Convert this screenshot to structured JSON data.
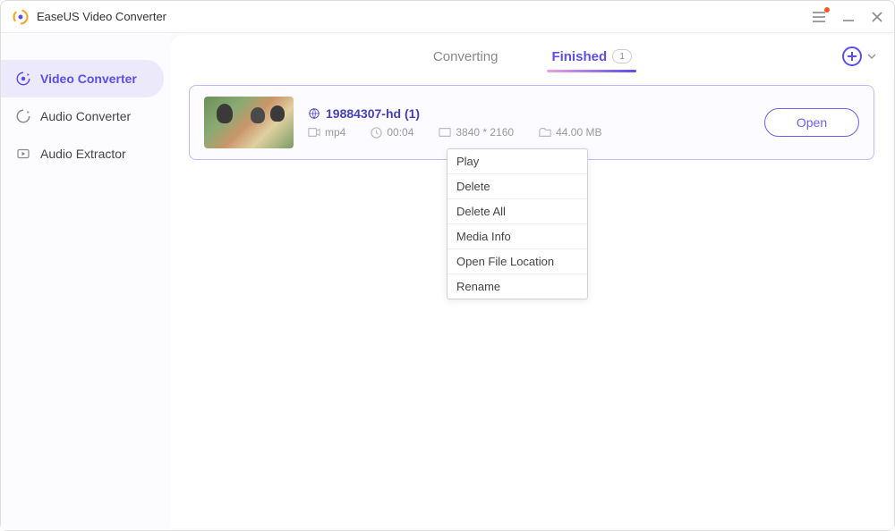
{
  "app": {
    "title": "EaseUS Video Converter"
  },
  "sidebar": {
    "items": [
      {
        "label": "Video Converter"
      },
      {
        "label": "Audio Converter"
      },
      {
        "label": "Audio Extractor"
      }
    ]
  },
  "tabs": {
    "converting": {
      "label": "Converting"
    },
    "finished": {
      "label": "Finished",
      "count": "1"
    }
  },
  "file": {
    "name": "19884307-hd (1)",
    "format": "mp4",
    "duration": "00:04",
    "resolution": "3840 * 2160",
    "size": "44.00 MB",
    "open_label": "Open"
  },
  "context_menu": {
    "items": [
      {
        "label": "Play"
      },
      {
        "label": "Delete"
      },
      {
        "label": "Delete All"
      },
      {
        "label": "Media Info"
      },
      {
        "label": "Open File Location"
      },
      {
        "label": "Rename"
      }
    ]
  }
}
